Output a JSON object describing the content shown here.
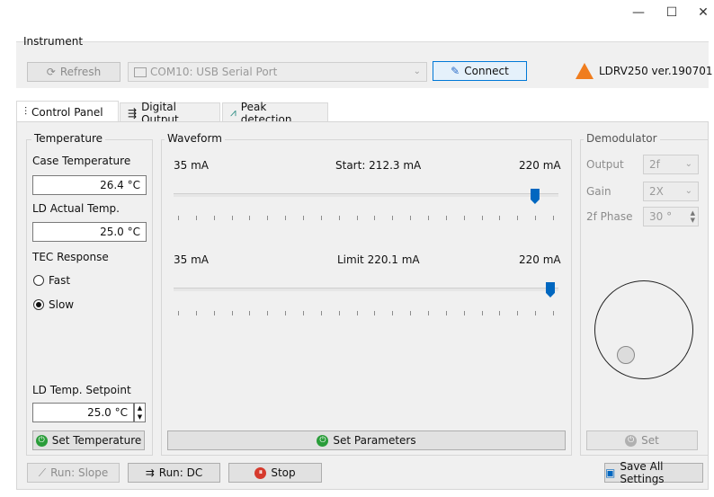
{
  "window": {
    "minimize": "—",
    "maximize": "☐",
    "close": "✕"
  },
  "instrument": {
    "label": "Instrument",
    "refresh_label": "Refresh",
    "port_value": "COM10: USB Serial Port",
    "connect_label": "Connect",
    "device_info": "LDRV250 ver.190701"
  },
  "tabs": [
    {
      "label": "Control Panel",
      "icon": "sliders-icon"
    },
    {
      "label": "Digital Output",
      "icon": "digital-output-icon"
    },
    {
      "label": "Peak detection",
      "icon": "peak-icon"
    }
  ],
  "temperature": {
    "label": "Temperature",
    "case_label": "Case Temperature",
    "case_value": "26.4 °C",
    "ld_actual_label": "LD Actual Temp.",
    "ld_actual_value": "25.0 °C",
    "tec_label": "TEC Response",
    "fast_label": "Fast",
    "slow_label": "Slow",
    "tec_selected": "Slow",
    "setpoint_label": "LD Temp. Setpoint",
    "setpoint_value": "25.0 °C",
    "set_button": "Set Temperature"
  },
  "waveform": {
    "label": "Waveform",
    "start_min": "35 mA",
    "start_readout": "Start:  212.3 mA",
    "start_max": "220 mA",
    "start_value_mA": 212.3,
    "limit_min": "35 mA",
    "limit_readout": "Limit  220.1 mA",
    "limit_max": "220 mA",
    "limit_value_mA": 220.1,
    "range_mA": [
      35,
      220
    ],
    "set_button": "Set Parameters"
  },
  "demodulator": {
    "label": "Demodulator",
    "output_label": "Output",
    "output_value": "2f",
    "gain_label": "Gain",
    "gain_value": "2X",
    "phase_label": "2f Phase",
    "phase_value": "30 °",
    "set_button": "Set"
  },
  "footer": {
    "run_slope": "Run: Slope",
    "run_dc": "Run: DC",
    "stop": "Stop",
    "save_all": "Save All Settings"
  },
  "colors": {
    "accent": "#0067c0",
    "green": "#2a9d3a",
    "red": "#d63a2d",
    "orange": "#f07d1e"
  }
}
